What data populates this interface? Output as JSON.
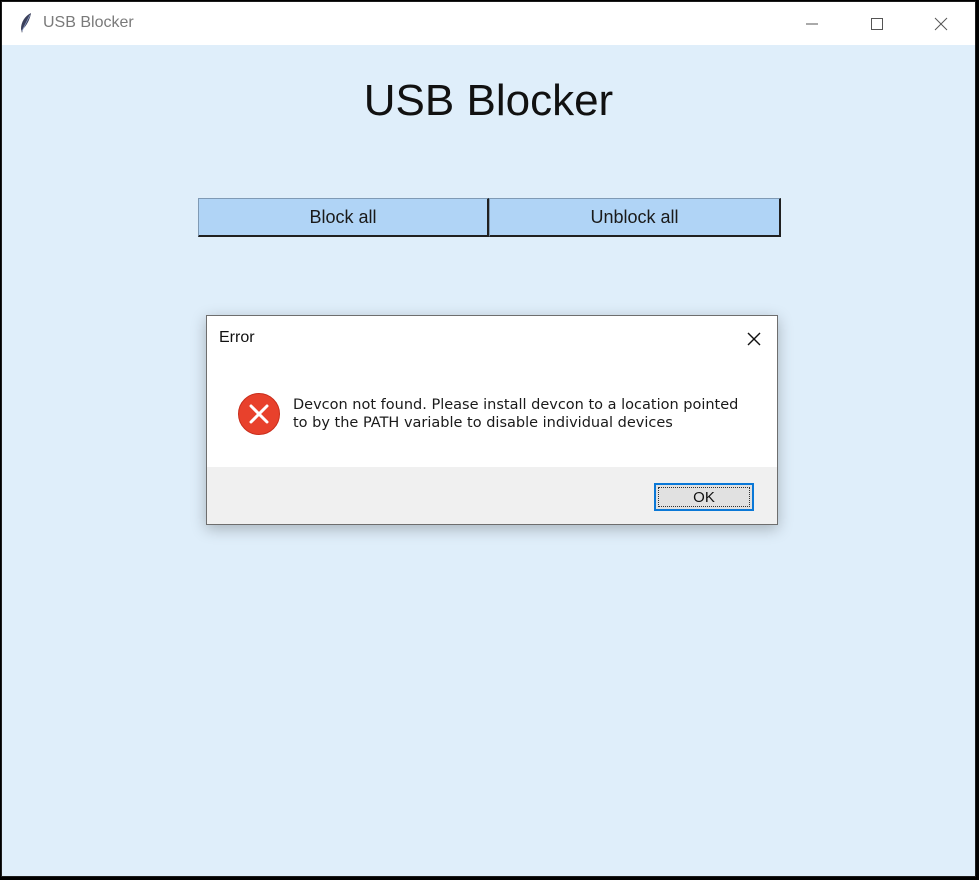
{
  "window": {
    "title": "USB Blocker",
    "icon": "feather-icon"
  },
  "main": {
    "heading": "USB Blocker",
    "buttons": {
      "block_all": "Block all",
      "unblock_all": "Unblock all"
    }
  },
  "dialog": {
    "title": "Error",
    "icon": "error-icon",
    "message_line1": "Devcon not found. Please install devcon to a location pointed",
    "message_line2": "to by the PATH variable to disable individual devices",
    "ok_label": "OK"
  },
  "colors": {
    "window_bg": "#dfeefa",
    "button_bg": "#b0d4f6",
    "error_red": "#e8412c",
    "focus_blue": "#0a78d7"
  }
}
